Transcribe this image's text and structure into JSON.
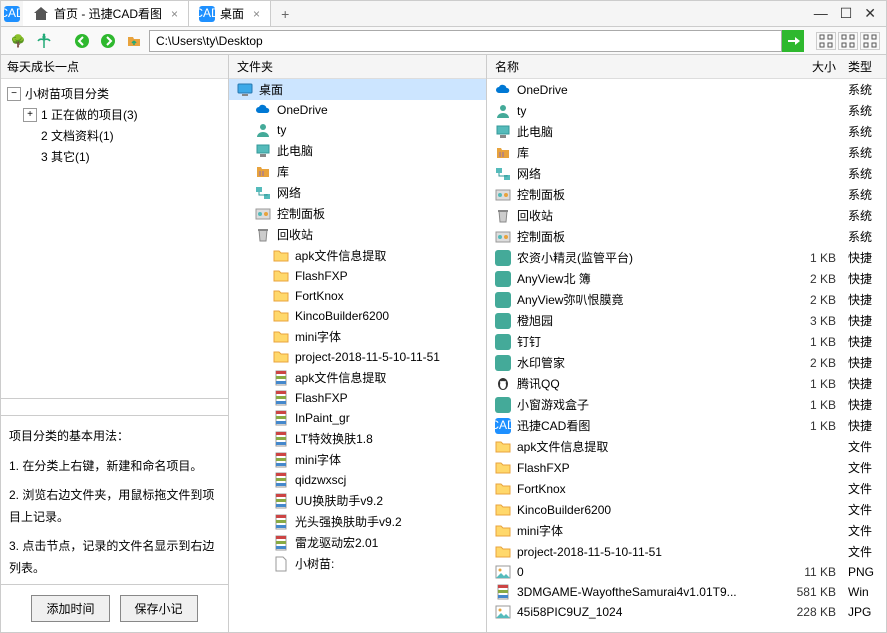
{
  "tabs": [
    {
      "label": "首页 - 迅捷CAD看图",
      "icon": "home"
    },
    {
      "label": "桌面",
      "icon": "cad",
      "active": true
    }
  ],
  "address": {
    "path": "C:\\Users\\ty\\Desktop"
  },
  "leftHeader": "每天成长一点",
  "tree": {
    "root": "小树苗项目分类",
    "items": [
      {
        "label": "1 正在做的项目(3)",
        "expandable": true
      },
      {
        "label": "2 文档资料(1)",
        "expandable": false
      },
      {
        "label": "3 其它(1)",
        "expandable": false
      }
    ]
  },
  "help": {
    "title": "项目分类的基本用法：",
    "lines": [
      "1. 在分类上右键，新建和命名项目。",
      "2. 浏览右边文件夹，用鼠标拖文件到项目上记录。",
      "3. 点击节点，记录的文件名显示到右边列表。"
    ]
  },
  "buttons": {
    "addTime": "添加时间",
    "saveNote": "保存小记"
  },
  "midHeader": "文件夹",
  "midItems": [
    {
      "label": "桌面",
      "icon": "desktop",
      "indent": 0,
      "sel": true
    },
    {
      "label": "OneDrive",
      "icon": "cloud",
      "indent": 1
    },
    {
      "label": "ty",
      "icon": "user",
      "indent": 1
    },
    {
      "label": "此电脑",
      "icon": "pc",
      "indent": 1
    },
    {
      "label": "库",
      "icon": "lib",
      "indent": 1
    },
    {
      "label": "网络",
      "icon": "net",
      "indent": 1
    },
    {
      "label": "控制面板",
      "icon": "ctrl",
      "indent": 1
    },
    {
      "label": "回收站",
      "icon": "bin",
      "indent": 1
    },
    {
      "label": "apk文件信息提取",
      "icon": "folder",
      "indent": 2
    },
    {
      "label": "FlashFXP",
      "icon": "folder",
      "indent": 2
    },
    {
      "label": "FortKnox",
      "icon": "folder",
      "indent": 2
    },
    {
      "label": "KincoBuilder6200",
      "icon": "folder",
      "indent": 2
    },
    {
      "label": "mini字体",
      "icon": "folder",
      "indent": 2
    },
    {
      "label": "project-2018-11-5-10-11-51",
      "icon": "folder",
      "indent": 2
    },
    {
      "label": "apk文件信息提取",
      "icon": "rar",
      "indent": 2
    },
    {
      "label": "FlashFXP",
      "icon": "rar",
      "indent": 2
    },
    {
      "label": "InPaint_gr",
      "icon": "rar",
      "indent": 2
    },
    {
      "label": "LT特效换肤1.8",
      "icon": "rar",
      "indent": 2
    },
    {
      "label": "mini字体",
      "icon": "rar",
      "indent": 2
    },
    {
      "label": "qidzwxscj",
      "icon": "rar",
      "indent": 2
    },
    {
      "label": "UU换肤助手v9.2",
      "icon": "rar",
      "indent": 2
    },
    {
      "label": "光头强换肤助手v9.2",
      "icon": "rar",
      "indent": 2
    },
    {
      "label": "雷龙驱动宏2.01",
      "icon": "rar",
      "indent": 2
    },
    {
      "label": "小树苗:",
      "icon": "file",
      "indent": 2
    }
  ],
  "rpHeaders": {
    "name": "名称",
    "size": "大小",
    "type": "类型"
  },
  "rpItems": [
    {
      "name": "OneDrive",
      "icon": "cloud",
      "size": "",
      "type": "系统"
    },
    {
      "name": "ty",
      "icon": "user",
      "size": "",
      "type": "系统"
    },
    {
      "name": "此电脑",
      "icon": "pc",
      "size": "",
      "type": "系统"
    },
    {
      "name": "库",
      "icon": "lib",
      "size": "",
      "type": "系统"
    },
    {
      "name": "网络",
      "icon": "net",
      "size": "",
      "type": "系统"
    },
    {
      "name": "控制面板",
      "icon": "ctrl",
      "size": "",
      "type": "系统"
    },
    {
      "name": "回收站",
      "icon": "bin",
      "size": "",
      "type": "系统"
    },
    {
      "name": "控制面板",
      "icon": "ctrl",
      "size": "",
      "type": "系统"
    },
    {
      "name": "农资小精灵(监管平台)",
      "icon": "app1",
      "size": "1 KB",
      "type": "快捷"
    },
    {
      "name": "AnyView北   簿",
      "icon": "app2",
      "size": "2 KB",
      "type": "快捷"
    },
    {
      "name": "AnyView弥叭恨膜竟",
      "icon": "app2",
      "size": "2 KB",
      "type": "快捷"
    },
    {
      "name": "橙旭园",
      "icon": "app3",
      "size": "3 KB",
      "type": "快捷"
    },
    {
      "name": "钉钉",
      "icon": "app4",
      "size": "1 KB",
      "type": "快捷"
    },
    {
      "name": "水印管家",
      "icon": "app5",
      "size": "2 KB",
      "type": "快捷"
    },
    {
      "name": "腾讯QQ",
      "icon": "qq",
      "size": "1 KB",
      "type": "快捷"
    },
    {
      "name": "小窗游戏盒子",
      "icon": "app6",
      "size": "1 KB",
      "type": "快捷"
    },
    {
      "name": "迅捷CAD看图",
      "icon": "cad",
      "size": "1 KB",
      "type": "快捷"
    },
    {
      "name": "apk文件信息提取",
      "icon": "folder",
      "size": "",
      "type": "文件"
    },
    {
      "name": "FlashFXP",
      "icon": "folder",
      "size": "",
      "type": "文件"
    },
    {
      "name": "FortKnox",
      "icon": "folder",
      "size": "",
      "type": "文件"
    },
    {
      "name": "KincoBuilder6200",
      "icon": "folder",
      "size": "",
      "type": "文件"
    },
    {
      "name": "mini字体",
      "icon": "folder",
      "size": "",
      "type": "文件"
    },
    {
      "name": "project-2018-11-5-10-11-51",
      "icon": "folder",
      "size": "",
      "type": "文件"
    },
    {
      "name": "0",
      "icon": "img",
      "size": "11 KB",
      "type": "PNG"
    },
    {
      "name": "3DMGAME-WayoftheSamurai4v1.01T9...",
      "icon": "rar",
      "size": "581 KB",
      "type": "Win"
    },
    {
      "name": "45i58PIC9UZ_1024",
      "icon": "img",
      "size": "228 KB",
      "type": "JPG"
    }
  ]
}
